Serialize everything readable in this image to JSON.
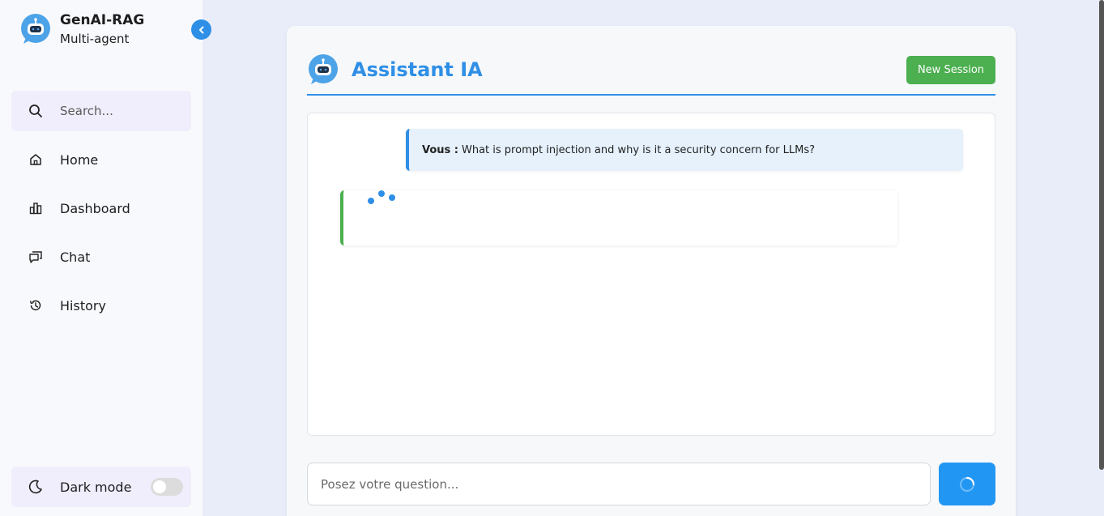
{
  "brand": {
    "title": "GenAI-RAG",
    "subtitle": "Multi-agent"
  },
  "sidebar": {
    "search_placeholder": "Search...",
    "items": [
      {
        "label": "Home",
        "icon": "home-icon"
      },
      {
        "label": "Dashboard",
        "icon": "bar-chart-icon"
      },
      {
        "label": "Chat",
        "icon": "chat-icon"
      },
      {
        "label": "History",
        "icon": "history-icon"
      }
    ],
    "dark_mode_label": "Dark mode",
    "dark_mode_enabled": false
  },
  "main": {
    "title": "Assistant IA",
    "new_session_label": "New Session",
    "messages": [
      {
        "role": "user",
        "sender": "Vous :",
        "text": "What is prompt injection and why is it a security concern for LLMs?"
      },
      {
        "role": "assistant",
        "state": "loading"
      }
    ],
    "input_placeholder": "Posez votre question...",
    "input_value": ""
  },
  "colors": {
    "accent": "#2f8fe6",
    "success": "#4caf50",
    "background": "#e8edf9"
  }
}
